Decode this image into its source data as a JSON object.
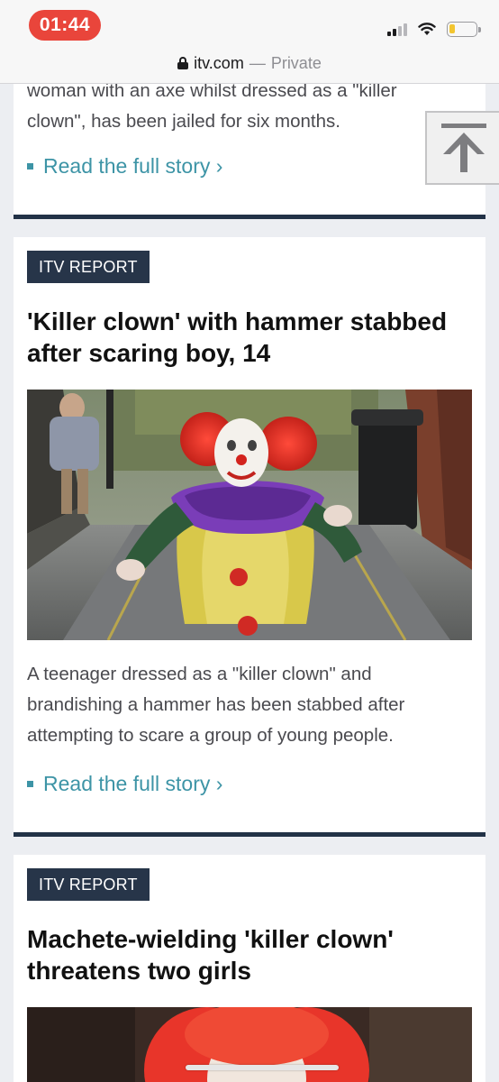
{
  "status_bar": {
    "time": "01:44",
    "battery_color": "#f2c530",
    "time_pill_color": "#e9453b"
  },
  "browser": {
    "lock_icon": "lock-icon",
    "domain": "itv.com",
    "separator": "—",
    "mode": "Private"
  },
  "colors": {
    "tag_background": "#273549",
    "card_rule": "#223247",
    "link": "#3d94a6"
  },
  "articles": [
    {
      "summary_tail": "woman with an axe whilst dressed as a \"killer clown\", has been jailed for six months.",
      "read_more": "Read the full story ›"
    },
    {
      "tag": "ITV REPORT",
      "headline": "'Killer clown' with hammer stabbed after scaring boy, 14",
      "image": "killer-clown-alley-photo",
      "summary": "A teenager dressed as a \"killer clown\" and brandishing a hammer has been stabbed after attempting to scare a group of young people.",
      "read_more": "Read the full story ›"
    },
    {
      "tag": "ITV REPORT",
      "headline": "Machete-wielding 'killer clown' threatens two girls",
      "image": "clown-red-hair-photo"
    }
  ],
  "back_to_top": {
    "icon": "arrow-up-icon"
  }
}
